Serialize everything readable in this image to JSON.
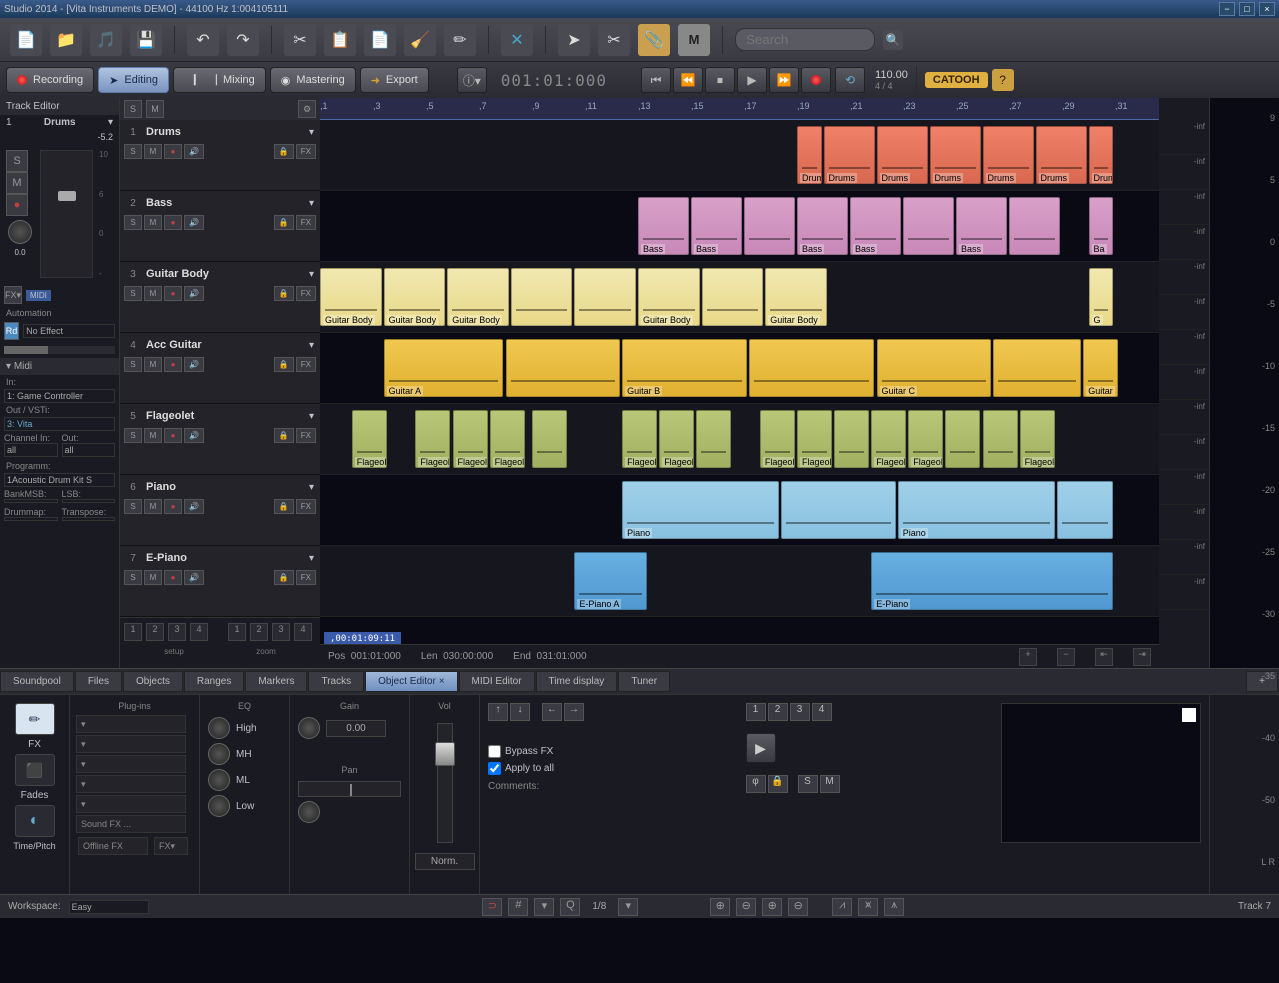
{
  "window": {
    "title": "Studio 2014 - [Vita Instruments DEMO] - 44100 Hz 1:004105111"
  },
  "search": {
    "placeholder": "Search"
  },
  "modes": {
    "recording": "Recording",
    "editing": "Editing",
    "mixing": "Mixing",
    "mastering": "Mastering",
    "export": "Export"
  },
  "timecode": "001:01:000",
  "tempo": "110.00",
  "bars": "4 / 4",
  "brand": "CATOOH",
  "trackEditor": {
    "title": "Track Editor",
    "num": "1",
    "name": "Drums",
    "peak": "-5.2",
    "pan": "0.0",
    "midiTag": "MIDI",
    "automation": "Automation",
    "rd": "Rd",
    "noEffect": "No Effect"
  },
  "midi": {
    "title": "Midi",
    "inLabel": "In:",
    "inVal": "1: Game Controller",
    "outLabel": "Out / VSTi:",
    "outVal": "3: Vita",
    "chInLabel": "Channel In:",
    "chInVal": "all",
    "chOutLabel": "Out:",
    "chOutVal": "all",
    "programLabel": "Programm:",
    "programVal": "1Acoustic Drum Kit S",
    "bankMsbLabel": "BankMSB:",
    "lsbLabel": "LSB:",
    "drummapLabel": "Drummap:",
    "transpLabel": "Transpose:"
  },
  "tracks": [
    {
      "num": "1",
      "name": "Drums"
    },
    {
      "num": "2",
      "name": "Bass"
    },
    {
      "num": "3",
      "name": "Guitar Body"
    },
    {
      "num": "4",
      "name": "Acc Guitar"
    },
    {
      "num": "5",
      "name": "Flageolet"
    },
    {
      "num": "6",
      "name": "Piano"
    },
    {
      "num": "7",
      "name": "E-Piano"
    }
  ],
  "ruler": [
    "1",
    "3",
    "5",
    "7",
    "9",
    "11",
    "13",
    "15",
    "17",
    "19",
    "21",
    "23",
    "25",
    "27",
    "29",
    "31"
  ],
  "infVal": "-inf",
  "clips": {
    "drumIn": "Drum_In",
    "drums": "Drums",
    "drum": "Drum",
    "bass": "Bass",
    "ba": "Ba",
    "guitarBody": "Guitar Body",
    "g": "G",
    "guitarA": "Guitar A",
    "guitarB": "Guitar B",
    "guitarC": "Guitar C",
    "guitar": "Guitar",
    "flageol": "Flageol",
    "flageole": "Flageole",
    "piano": "Piano",
    "epianoA": "E-Piano A",
    "epiano": "E-Piano"
  },
  "posbox": ",00:01:09:11",
  "status": {
    "posLabel": "Pos",
    "posVal": "001:01:000",
    "lenLabel": "Len",
    "lenVal": "030:00:000",
    "endLabel": "End",
    "endVal": "031:01:000",
    "setup": "setup",
    "zoom": "zoom"
  },
  "tabs": {
    "soundpool": "Soundpool",
    "files": "Files",
    "objects": "Objects",
    "ranges": "Ranges",
    "markers": "Markers",
    "tracks": "Tracks",
    "objEditor": "Object Editor",
    "midiEditor": "MIDI Editor",
    "timeDisplay": "Time display",
    "tuner": "Tuner"
  },
  "oe": {
    "fx": "FX",
    "fades": "Fades",
    "timePitch": "Time/Pitch",
    "plugins": "Plug-ins",
    "soundFx": "Sound FX ...",
    "offlineFx": "Offline FX",
    "fxBtn": "FX",
    "eq": "EQ",
    "high": "High",
    "mh": "MH",
    "ml": "ML",
    "low": "Low",
    "gain": "Gain",
    "gainVal": "0.00",
    "pan": "Pan",
    "vol": "Vol",
    "norm": "Norm.",
    "bypass": "Bypass FX",
    "applyAll": "Apply to all",
    "comments": "Comments:",
    "nums": [
      "1",
      "2",
      "3",
      "4"
    ]
  },
  "footer": {
    "workspace": "Workspace:",
    "easy": "Easy",
    "snap": "1/8",
    "trackStatus": "Track 7"
  },
  "meterScale": [
    "9",
    "5",
    "0",
    "-5",
    "-10",
    "-15",
    "-20",
    "-25",
    "-30",
    "-35",
    "-40",
    "-50",
    "L   R"
  ]
}
